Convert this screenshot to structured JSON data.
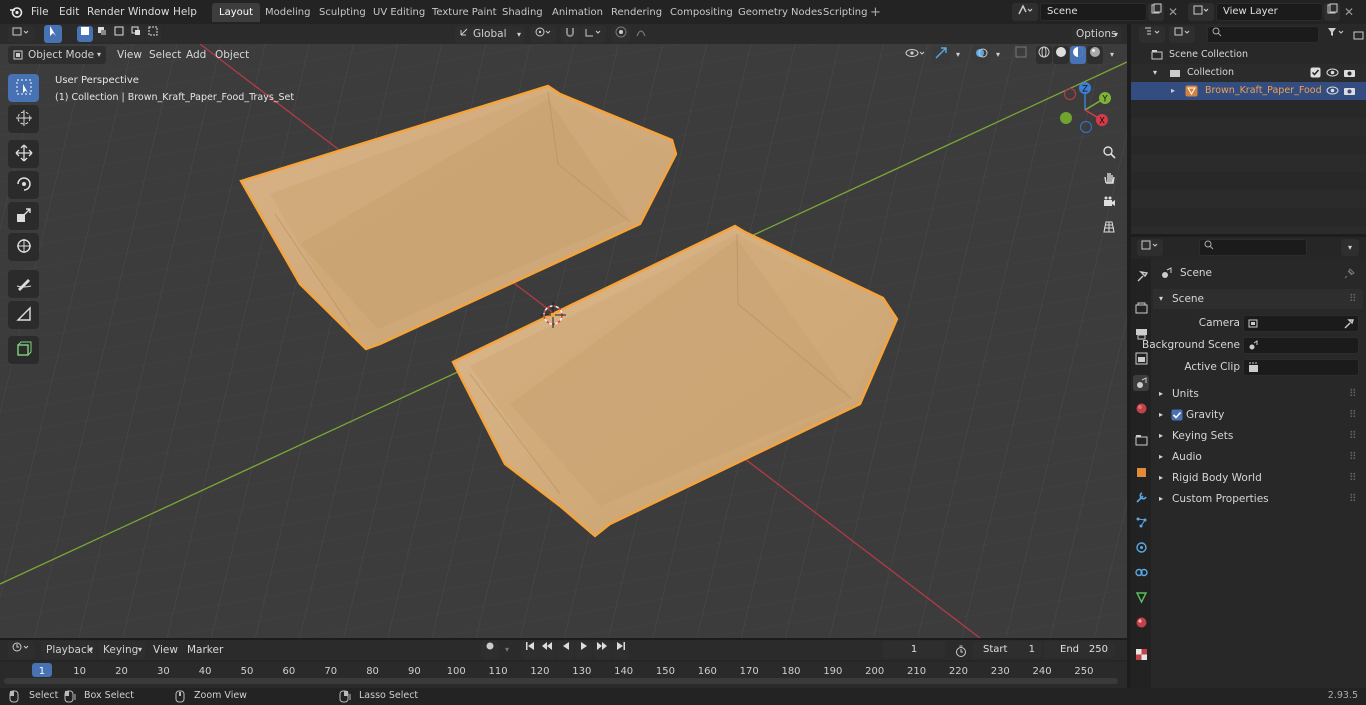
{
  "top_menu": {
    "items": [
      "File",
      "Edit",
      "Render",
      "Window",
      "Help"
    ],
    "workspaces": [
      "Layout",
      "Modeling",
      "Sculpting",
      "UV Editing",
      "Texture Paint",
      "Shading",
      "Animation",
      "Rendering",
      "Compositing",
      "Geometry Nodes",
      "Scripting"
    ],
    "active_workspace": "Layout",
    "scene_name": "Scene",
    "view_layer": "View Layer"
  },
  "viewport": {
    "mode": "Object Mode",
    "menus": [
      "View",
      "Select",
      "Add",
      "Object"
    ],
    "transform_orientation": "Global",
    "options_label": "Options",
    "overlay_title": "User Perspective",
    "overlay_subtitle": "(1) Collection | Brown_Kraft_Paper_Food_Trays_Set",
    "gizmo_axes": [
      "Z",
      "Y",
      "X"
    ],
    "tools": [
      "select-box",
      "cursor",
      "move",
      "rotate",
      "scale",
      "transform",
      "annotate",
      "measure",
      "add-cube"
    ]
  },
  "outliner": {
    "scene_collection": "Scene Collection",
    "collection": "Collection",
    "object": "Brown_Kraft_Paper_Food"
  },
  "properties": {
    "context": "Scene",
    "section": "Scene",
    "fields": [
      {
        "label": "Camera",
        "value": ""
      },
      {
        "label": "Background Scene",
        "value": ""
      },
      {
        "label": "Active Clip",
        "value": ""
      }
    ],
    "subpanels": [
      "Units",
      "Gravity",
      "Keying Sets",
      "Audio",
      "Rigid Body World",
      "Custom Properties"
    ],
    "gravity_checked": true
  },
  "timeline": {
    "menus": [
      "Playback",
      "Keying",
      "View",
      "Marker"
    ],
    "current_frame": "1",
    "start_label": "Start",
    "start_value": "1",
    "end_label": "End",
    "end_value": "250",
    "ruler": [
      "1",
      "10",
      "20",
      "30",
      "40",
      "50",
      "60",
      "70",
      "80",
      "90",
      "100",
      "110",
      "120",
      "130",
      "140",
      "150",
      "160",
      "170",
      "180",
      "190",
      "200",
      "210",
      "220",
      "230",
      "240",
      "250"
    ]
  },
  "statusbar": {
    "select": "Select",
    "box_select": "Box Select",
    "zoom_view": "Zoom View",
    "lasso_select": "Lasso Select",
    "version": "2.93.5"
  },
  "colors": {
    "accent": "#4772b3",
    "selection_outline": "#f5a33a",
    "tray_fill": "#d8b283",
    "x_axis": "#c23a4a",
    "y_axis": "#7fb239"
  }
}
